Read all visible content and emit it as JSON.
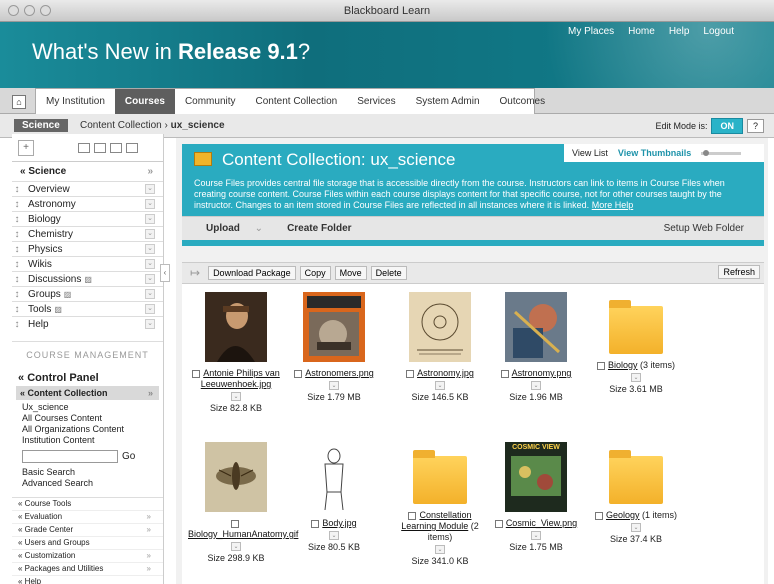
{
  "window": {
    "title": "Blackboard Learn"
  },
  "header": {
    "title_prefix": "What's New in ",
    "title_bold": "Release 9.1",
    "title_suffix": "?",
    "links": [
      "My Places",
      "Home",
      "Help",
      "Logout"
    ]
  },
  "tabs": [
    "My Institution",
    "Courses",
    "Community",
    "Content Collection",
    "Services",
    "System Admin",
    "Outcomes"
  ],
  "active_tab": "Courses",
  "breadcrumb": {
    "course": "Science",
    "parent": "Content Collection",
    "sep": "›",
    "current": "ux_science"
  },
  "edit_mode": {
    "label": "Edit Mode is:",
    "value": "ON",
    "help": "?"
  },
  "sidebar": {
    "course_name": "Science",
    "items": [
      {
        "label": "Overview"
      },
      {
        "label": "Astronomy"
      },
      {
        "label": "Biology"
      },
      {
        "label": "Chemistry"
      },
      {
        "label": "Physics"
      },
      {
        "label": "Wikis"
      },
      {
        "label": "Discussions"
      },
      {
        "label": "Groups"
      },
      {
        "label": "Tools"
      },
      {
        "label": "Help"
      }
    ],
    "course_management": "COURSE MANAGEMENT",
    "control_panel": "Control Panel",
    "content_collection": "Content Collection",
    "cc_links": [
      "Ux_science",
      "All Courses Content",
      "All Organizations Content",
      "Institution Content"
    ],
    "go_label": "Go",
    "search_links": [
      "Basic Search",
      "Advanced Search"
    ],
    "tools": [
      "Course Tools",
      "Evaluation",
      "Grade Center",
      "Users and Groups",
      "Customization",
      "Packages and Utilities",
      "Help"
    ]
  },
  "main": {
    "title": "Content Collection: ux_science",
    "view_list": "View List",
    "view_thumbnails": "View Thumbnails",
    "description": "Course Files provides central file storage that is accessible directly from the course. Instructors can link to items in Course Files when creating course content. Course Files within each course displays content for that specific course, not for other courses taught by the instructor. Changes to an item stored in Course Files are reflected in all instances where it is linked.",
    "more_help": "More Help",
    "upload": "Upload",
    "create_folder": "Create Folder",
    "setup_web_folder": "Setup Web Folder",
    "buttons": [
      "Download Package",
      "Copy",
      "Move",
      "Delete"
    ],
    "refresh": "Refresh",
    "items": [
      {
        "name": "Antonie Philips van Leeuwenhoek.jpg",
        "size": "Size 82.8 KB",
        "kind": "image"
      },
      {
        "name": "Astronomers.png",
        "size": "Size 1.79 MB",
        "kind": "image"
      },
      {
        "name": "Astronomy.jpg",
        "size": "Size 146.5 KB",
        "kind": "image"
      },
      {
        "name": "Astronomy.png",
        "size": "Size 1.96 MB",
        "kind": "image"
      },
      {
        "name": "Biology",
        "extra": "(3 items)",
        "size": "Size 3.61 MB",
        "kind": "folder"
      },
      {
        "name": "Biology_HumanAnatomy.gif",
        "size": "Size 298.9 KB",
        "kind": "image"
      },
      {
        "name": "Body.jpg",
        "size": "Size 80.5 KB",
        "kind": "image"
      },
      {
        "name": "Constellation Learning Module",
        "extra": "(2 items)",
        "size": "Size 341.0 KB",
        "kind": "folder"
      },
      {
        "name": "Cosmic_View.png",
        "size": "Size 1.75 MB",
        "kind": "image",
        "label": "COSMIC VIEW"
      },
      {
        "name": "Geology",
        "extra": "(1 items)",
        "size": "Size 37.4 KB",
        "kind": "folder"
      }
    ]
  }
}
